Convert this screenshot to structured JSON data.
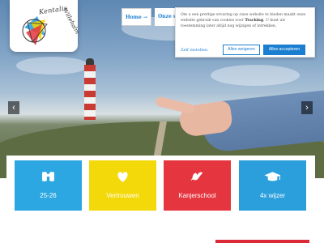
{
  "logo": {
    "text_top": "Kentalis",
    "text_side": "Willehalm"
  },
  "nav": {
    "items": [
      {
        "label": "Home →",
        "active": true
      },
      {
        "label": "Onze scho"
      }
    ]
  },
  "cookie_banner": {
    "text_part1": "Om u een prettige ervaring op onze website te bieden maakt onze website gebruik van cookies voor ",
    "text_bold": "Tracking",
    "text_part2": ". U kunt uw toestemming later altijd nog wijzigen of intrekken.",
    "settings_label": "Zelf instellen",
    "reject_label": "Alles weigeren",
    "accept_label": "Alles accepteren"
  },
  "slider": {
    "prev_icon": "chevron-left-icon",
    "next_icon": "chevron-right-icon"
  },
  "tiles": [
    {
      "label": "25-26",
      "icon": "binoculars-icon",
      "color": "#2da7e1"
    },
    {
      "label": "Vertrouwen",
      "icon": "heart-icon",
      "color": "#f4d90a"
    },
    {
      "label": "Kanjerschool",
      "icon": "dove-icon",
      "color": "#e5353f"
    },
    {
      "label": "4x wijzer",
      "icon": "graduation-cap-icon",
      "color": "#2a9fdc"
    }
  ],
  "colors": {
    "accent": "#1b7fd1",
    "brand_red": "#d92a35"
  }
}
